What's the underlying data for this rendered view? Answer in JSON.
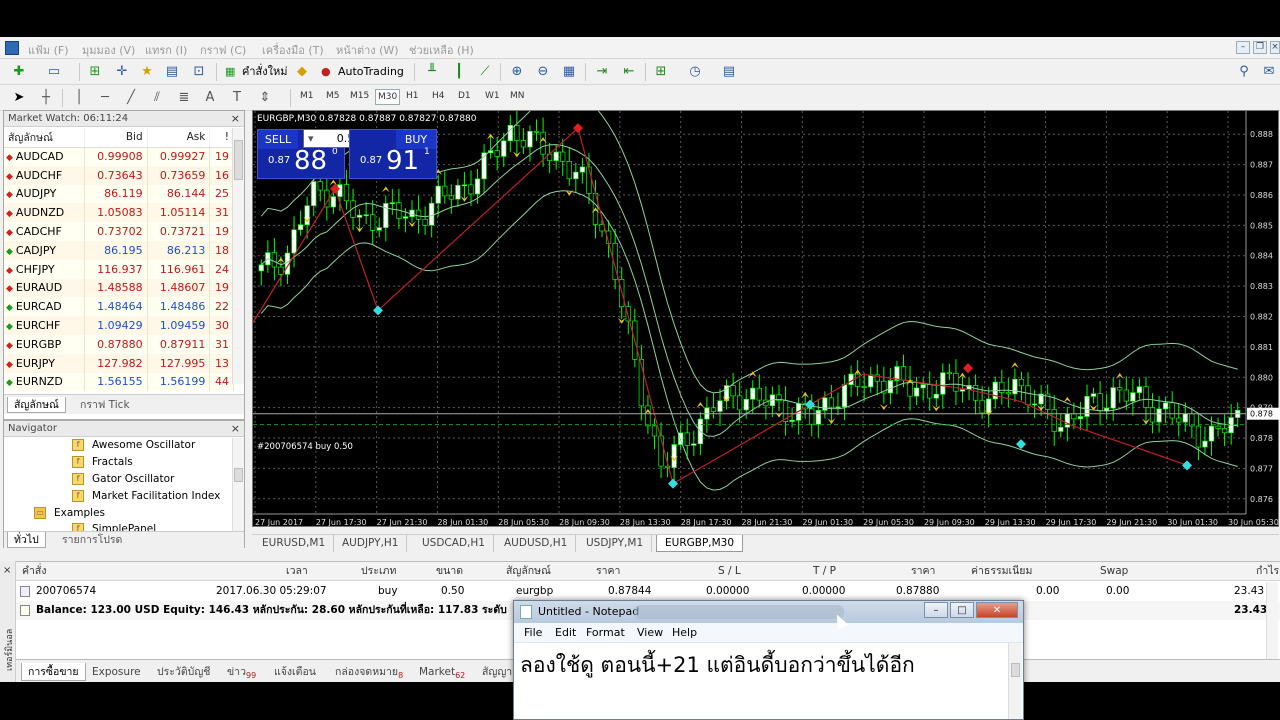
{
  "menu": [
    "แฟ้ม (F)",
    "มุมมอง (V)",
    "แทรก (I)",
    "กราฟ (C)",
    "เครื่องมือ (T)",
    "หน้าต่าง (W)",
    "ช่วยเหลือ (H)"
  ],
  "toolbar": {
    "new_order": "คำสั่งใหม่",
    "autotrading": "AutoTrading"
  },
  "timeframes": [
    "M1",
    "M5",
    "M15",
    "M30",
    "H1",
    "H4",
    "D1",
    "W1",
    "MN"
  ],
  "active_timeframe": "M30",
  "market_watch": {
    "title": "Market Watch: 06:11:24",
    "columns": [
      "สัญลักษณ์",
      "Bid",
      "Ask",
      "!"
    ],
    "rows": [
      {
        "dir": "down",
        "symbol": "AUDCAD",
        "bid": "0.99908",
        "ask": "0.99927",
        "spread": "19"
      },
      {
        "dir": "down",
        "symbol": "AUDCHF",
        "bid": "0.73643",
        "ask": "0.73659",
        "spread": "16"
      },
      {
        "dir": "down",
        "symbol": "AUDJPY",
        "bid": "86.119",
        "ask": "86.144",
        "spread": "25"
      },
      {
        "dir": "down",
        "symbol": "AUDNZD",
        "bid": "1.05083",
        "ask": "1.05114",
        "spread": "31"
      },
      {
        "dir": "down",
        "symbol": "CADCHF",
        "bid": "0.73702",
        "ask": "0.73721",
        "spread": "19"
      },
      {
        "dir": "up",
        "symbol": "CADJPY",
        "bid": "86.195",
        "ask": "86.213",
        "spread": "18"
      },
      {
        "dir": "down",
        "symbol": "CHFJPY",
        "bid": "116.937",
        "ask": "116.961",
        "spread": "24"
      },
      {
        "dir": "down",
        "symbol": "EURAUD",
        "bid": "1.48588",
        "ask": "1.48607",
        "spread": "19"
      },
      {
        "dir": "up",
        "symbol": "EURCAD",
        "bid": "1.48464",
        "ask": "1.48486",
        "spread": "22"
      },
      {
        "dir": "up",
        "symbol": "EURCHF",
        "bid": "1.09429",
        "ask": "1.09459",
        "spread": "30"
      },
      {
        "dir": "down",
        "symbol": "EURGBP",
        "bid": "0.87880",
        "ask": "0.87911",
        "spread": "31"
      },
      {
        "dir": "down",
        "symbol": "EURJPY",
        "bid": "127.982",
        "ask": "127.995",
        "spread": "13"
      },
      {
        "dir": "up",
        "symbol": "EURNZD",
        "bid": "1.56155",
        "ask": "1.56199",
        "spread": "44"
      }
    ],
    "tabs": [
      "สัญลักษณ์",
      "กราฟ Tick"
    ]
  },
  "navigator": {
    "title": "Navigator",
    "items": [
      "Awesome Oscillator",
      "Fractals",
      "Gator Oscillator",
      "Market Facilitation Index",
      "Examples",
      "SimplePanel"
    ],
    "tabs": [
      "ทั่วไป",
      "รายการโปรด"
    ]
  },
  "chart": {
    "header": "EURGBP,M30  0.87828 0.87887 0.87827 0.87880",
    "sell_label": "SELL",
    "buy_label": "BUY",
    "volume": "0.50",
    "sell_small": "0.87",
    "sell_big": "88",
    "sell_exp": "0",
    "buy_small": "0.87",
    "buy_big": "91",
    "buy_exp": "1",
    "order_line_label": "#200706574 buy 0.50",
    "price_ticks": [
      "0.888",
      "0.887",
      "0.886",
      "0.885",
      "0.884",
      "0.883",
      "0.882",
      "0.881",
      "0.880",
      "0.879",
      "0.878",
      "0.877",
      "0.876"
    ],
    "current_price": "0.878",
    "time_ticks": [
      "27 Jun 2017",
      "27 Jun 17:30",
      "27 Jun 21:30",
      "28 Jun 01:30",
      "28 Jun 05:30",
      "28 Jun 09:30",
      "28 Jun 13:30",
      "28 Jun 17:30",
      "28 Jun 21:30",
      "29 Jun 01:30",
      "29 Jun 05:30",
      "29 Jun 09:30",
      "29 Jun 13:30",
      "29 Jun 17:30",
      "29 Jun 21:30",
      "30 Jun 01:30",
      "30 Jun 05:30"
    ],
    "colors": {
      "bull": "#ffffff",
      "bear": "#000000",
      "wick": "#00ff00",
      "band": "#8fcf9f",
      "zigzag": "#c0202a",
      "arrow": "#e8c020",
      "diamond": "#30e0e0"
    }
  },
  "chart_tabs": [
    "EURUSD,M1",
    "AUDJPY,H1",
    "USDCAD,H1",
    "AUDUSD,H1",
    "USDJPY,M1",
    "EURGBP,M30"
  ],
  "active_chart_tab": "EURGBP,M30",
  "terminal": {
    "headers": [
      "คำสั่ง",
      "เวลา",
      "ประเภท",
      "ขนาด",
      "สัญลักษณ์",
      "ราคา",
      "S / L",
      "T / P",
      "ราคา",
      "ค่าธรรมเนียม",
      "Swap",
      "กำไร"
    ],
    "order": {
      "ticket": "200706574",
      "time": "2017.06.30 05:29:07",
      "type": "buy",
      "size": "0.50",
      "symbol": "eurgbp",
      "price": "0.87844",
      "sl": "0.00000",
      "tp": "0.00000",
      "cur_price": "0.87880",
      "commission": "0.00",
      "swap": "0.00",
      "profit": "23.43"
    },
    "balance_line": "Balance: 123.00 USD  Equity: 146.43  หลักประกัน: 28.60  หลักประกันที่เหลือ: 117.83  ระดับ",
    "balance_profit": "23.43",
    "tabs": [
      "การซื้อขาย",
      "Exposure",
      "ประวัติบัญชี",
      "ข่าว",
      "แจ้งเตือน",
      "กล่องจดหมาย",
      "Market",
      "สัญญา"
    ],
    "tab_badges": {
      "news": "99",
      "mail": "8",
      "market": "62"
    },
    "side_label": "เทอร์มินอล"
  },
  "notepad": {
    "title": "Untitled - Notepad",
    "menu": [
      "File",
      "Edit",
      "Format",
      "View",
      "Help"
    ],
    "text": "ลองใช้ดู ตอนนี้+21 แต่อินดี้บอกว่าขึ้นได้อีก"
  }
}
